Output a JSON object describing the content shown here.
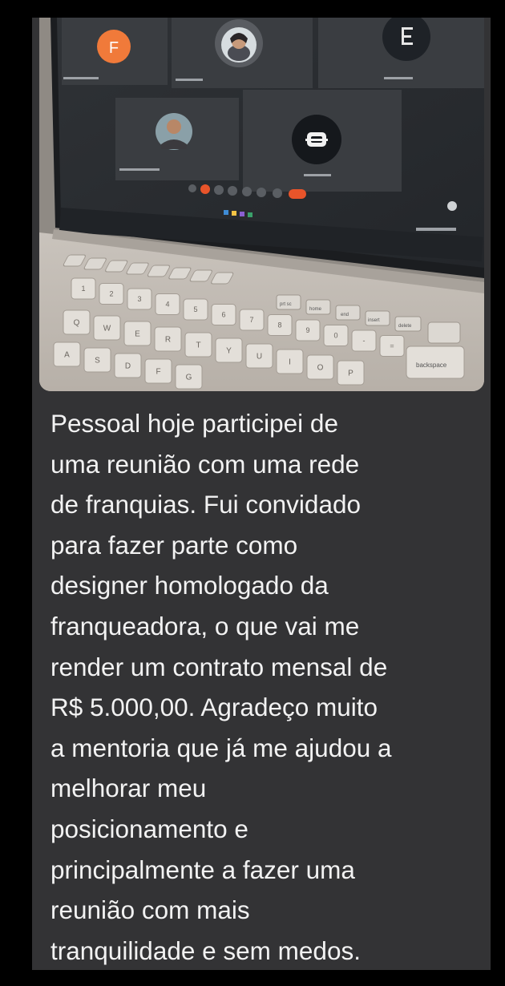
{
  "message": {
    "text": "Pessoal hoje participei de\numa reunião com uma rede\nde franquias. Fui convidado\npara fazer parte como\ndesigner homologado da\nfranqueadora, o que vai me\nrender um contrato mensal de\nR$ 5.000,00. Agradeço muito\na mentoria que já me ajudou a\nmelhorar meu\nposicionamento e\nprincipalmente a fazer uma\nreunião com mais\ntranquilidade e sem medos."
  },
  "photo": {
    "meeting_tiles": [
      {
        "avatar_letter": "F",
        "avatar_color": "#f07a3a"
      },
      {
        "avatar_kind": "person-photo"
      },
      {
        "avatar_kind": "logo",
        "avatar_color": "#1e2227"
      },
      {
        "avatar_kind": "person-photo"
      },
      {
        "avatar_kind": "logo",
        "avatar_color": "#15181c"
      }
    ],
    "keyboard_keys_row1": [
      "!\n1",
      "@\n2",
      "#\n3",
      "$\n4",
      "%\n5",
      "¨\n6",
      "&\n7",
      "*\n8",
      "(\n9",
      ")\n0",
      "_\n-",
      "+\n="
    ],
    "keyboard_keys_row2": [
      "Q",
      "W",
      "E",
      "R",
      "T",
      "Y",
      "U",
      "I",
      "O",
      "P"
    ],
    "keyboard_keys_row3": [
      "A",
      "S",
      "D",
      "F",
      "G"
    ],
    "backspace_label": "backspace",
    "delete_label": "delete",
    "insert_label": "insert",
    "end_label": "end",
    "home_label": "home",
    "prtsc_label": "prt sc"
  },
  "colors": {
    "bubble": "#333335",
    "text": "#f2f2f2",
    "end_call": "#e8542a"
  }
}
